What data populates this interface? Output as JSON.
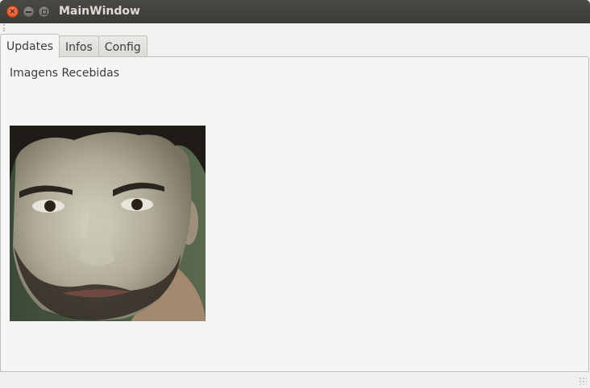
{
  "window": {
    "title": "MainWindow",
    "close_glyph": "×",
    "close_icon": "close-icon",
    "minimize_icon": "minimize-icon",
    "maximize_icon": "maximize-icon"
  },
  "tabs": [
    {
      "label": "Updates",
      "active": true
    },
    {
      "label": "Infos",
      "active": false
    },
    {
      "label": "Config",
      "active": false
    }
  ],
  "updates": {
    "heading": "Imagens Recebidas",
    "image_alt": "received face photo"
  }
}
